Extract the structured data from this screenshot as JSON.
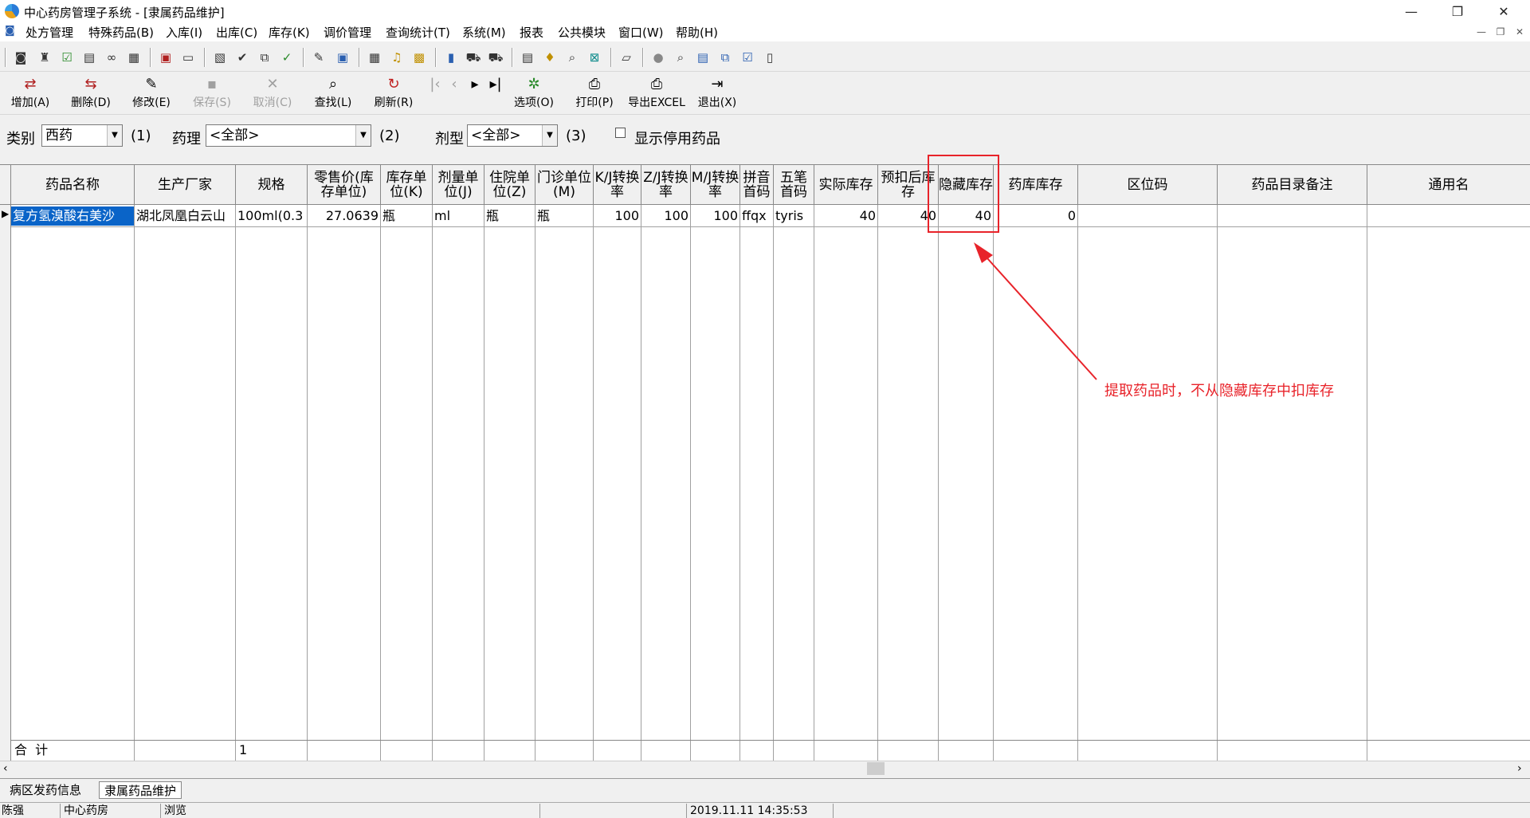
{
  "window": {
    "title": "中心药房管理子系统 - [隶属药品维护]",
    "minimize": "—",
    "restore": "❐",
    "close": "✕"
  },
  "menu": [
    "处方管理",
    "特殊药品(B)",
    "入库(I)",
    "出库(C)",
    "库存(K)",
    "调价管理",
    "查询统计(T)",
    "系统(M)",
    "报表",
    "公共模块",
    "窗口(W)",
    "帮助(H)"
  ],
  "toolbar_actions": [
    {
      "label": "增加(A)",
      "icon": "add-row-icon",
      "enabled": true
    },
    {
      "label": "删除(D)",
      "icon": "delete-row-icon",
      "enabled": true
    },
    {
      "label": "修改(E)",
      "icon": "edit-icon",
      "enabled": true
    },
    {
      "label": "保存(S)",
      "icon": "save-icon",
      "enabled": false
    },
    {
      "label": "取消(C)",
      "icon": "cancel-icon",
      "enabled": false
    },
    {
      "label": "查找(L)",
      "icon": "search-icon",
      "enabled": true
    },
    {
      "label": "刷新(R)",
      "icon": "refresh-icon",
      "enabled": true
    },
    {
      "label": "选项(O)",
      "icon": "options-icon",
      "enabled": true
    },
    {
      "label": "打印(P)",
      "icon": "print-icon",
      "enabled": true
    },
    {
      "label": "导出EXCEL",
      "icon": "export-excel-icon",
      "enabled": true
    },
    {
      "label": "退出(X)",
      "icon": "exit-icon",
      "enabled": true
    }
  ],
  "filters": {
    "category_label": "类别",
    "category_value": "西药",
    "category_hint": "(1)",
    "pharmacology_label": "药理",
    "pharmacology_value": "<全部>",
    "pharmacology_hint": "(2)",
    "dosage_form_label": "剂型",
    "dosage_form_value": "<全部>",
    "dosage_form_hint": "(3)",
    "show_disabled_label": "显示停用药品",
    "show_disabled_checked": false
  },
  "grid": {
    "columns": [
      "药品名称",
      "生产厂家",
      "规格",
      "零售价(库存单位)",
      "库存单位(K)",
      "剂量单位(J)",
      "住院单位(Z)",
      "门诊单位(M)",
      "K/J转换率",
      "Z/J转换率",
      "M/J转换率",
      "拼音首码",
      "五笔首码",
      "实际库存",
      "预扣后库存",
      "隐藏库存",
      "药库库存",
      "区位码",
      "药品目录备注",
      "通用名"
    ],
    "rows": [
      [
        "复方氢溴酸右美沙",
        "湖北凤凰白云山",
        "100ml(0.3",
        "27.0639",
        "瓶",
        "ml",
        "瓶",
        "瓶",
        "100",
        "100",
        "100",
        "ffqx",
        "tyris",
        "40",
        "40",
        "40",
        "0",
        "",
        "",
        ""
      ]
    ],
    "total_label": "合  计",
    "total_count": "1"
  },
  "annotation": {
    "text": "提取药品时，不从隐藏库存中扣库存",
    "color": "#e8232a"
  },
  "tabs": [
    {
      "label": "病区发药信息",
      "active": false
    },
    {
      "label": "隶属药品维护",
      "active": true
    }
  ],
  "status": {
    "user": "陈强",
    "department": "中心药房",
    "mode": "浏览",
    "datetime": "2019.11.11 14:35:53"
  },
  "colors": {
    "selection": "#0a64c8",
    "annotation": "#e8232a"
  }
}
